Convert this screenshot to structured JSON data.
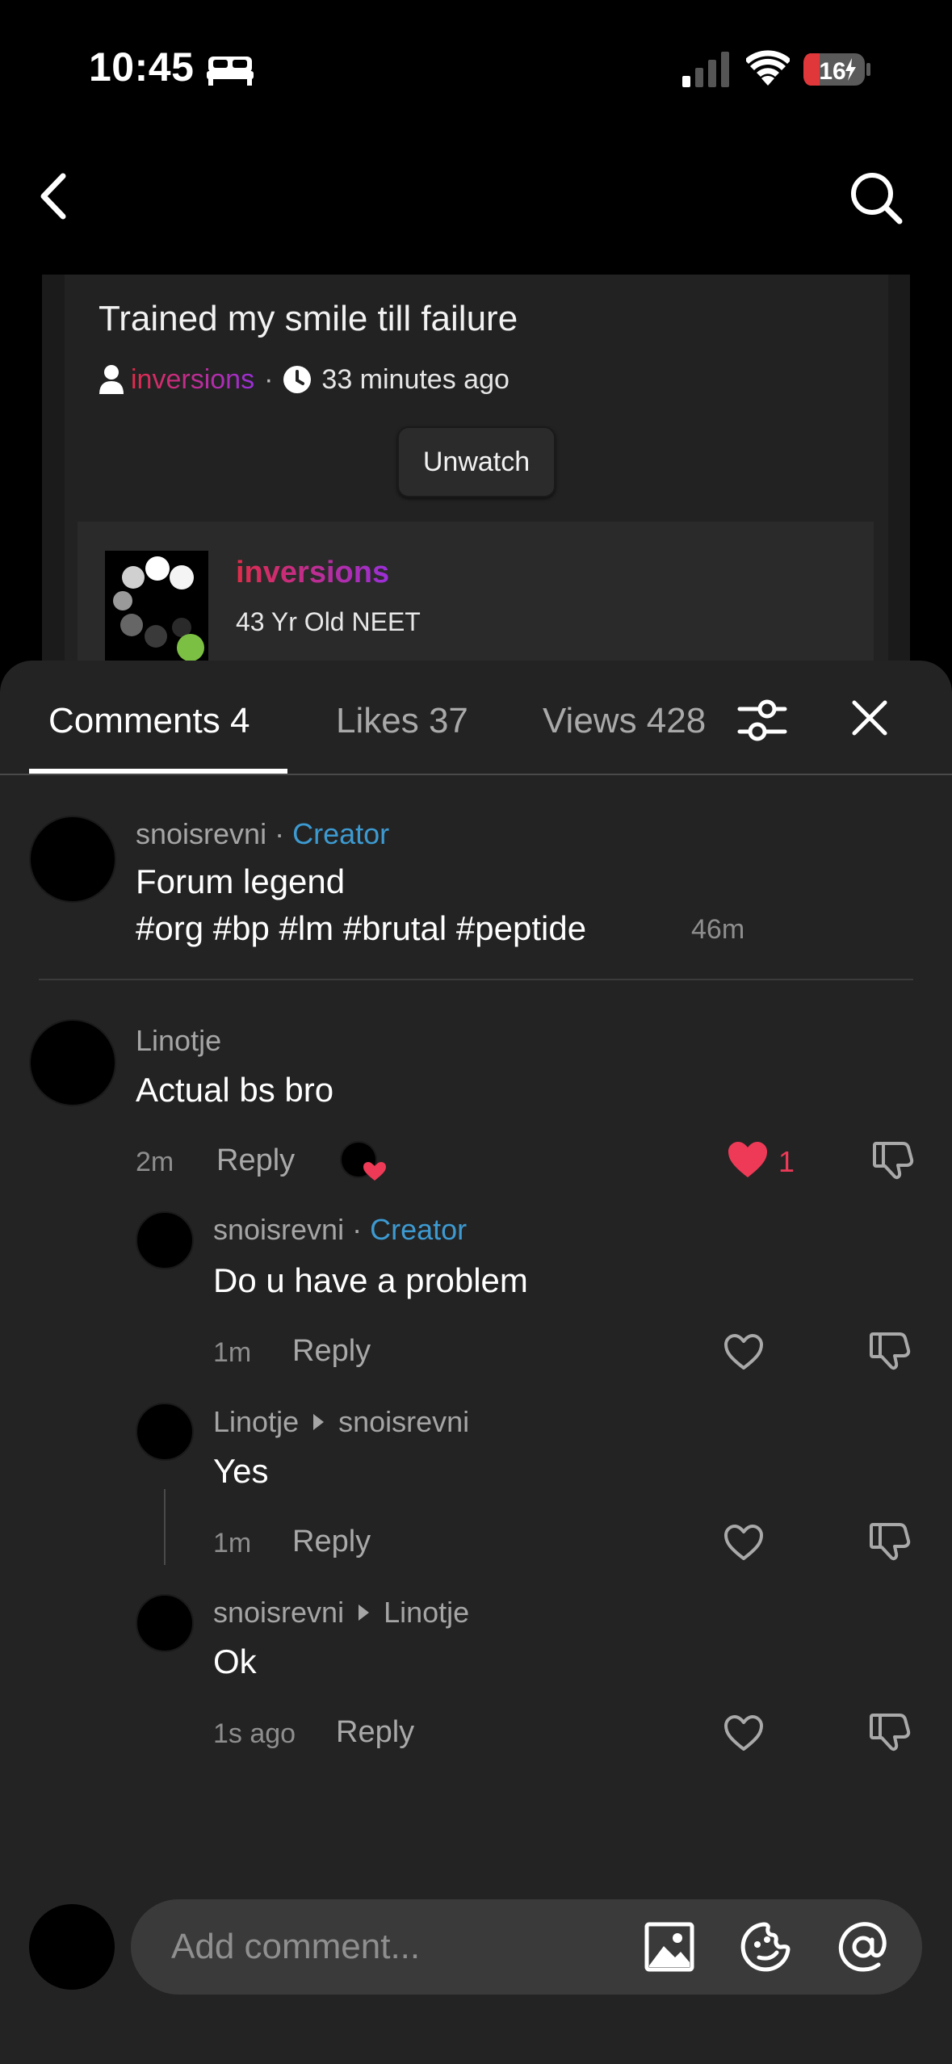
{
  "status_bar": {
    "time": "10:45",
    "battery": "16"
  },
  "post": {
    "title": "Trained my smile till failure",
    "author": "inversions",
    "meta_separator": "·",
    "time_ago": "33 minutes ago",
    "watch_button": "Unwatch"
  },
  "profile": {
    "name": "inversions",
    "bio": "43 Yr Old NEET"
  },
  "tabs": {
    "comments": "Comments 4",
    "likes": "Likes 37",
    "views": "Views 428"
  },
  "creator_comment": {
    "username": "snoisrevni",
    "separator": "·",
    "badge": "Creator",
    "line1": "Forum legend",
    "line2": "#org #bp #lm #brutal #peptide",
    "time": "46m"
  },
  "comments": [
    {
      "username": "Linotje",
      "text": "Actual bs bro",
      "time": "2m",
      "reply": "Reply",
      "likes": "1",
      "liked": true
    },
    {
      "username": "snoisrevni",
      "separator": "·",
      "badge": "Creator",
      "text": "Do u have a problem",
      "time": "1m",
      "reply": "Reply"
    },
    {
      "username": "Linotje",
      "reply_to": "snoisrevni",
      "text": "Yes",
      "time": "1m",
      "reply": "Reply"
    },
    {
      "username": "snoisrevni",
      "reply_to": "Linotje",
      "text": "Ok",
      "time": "1s ago",
      "reply": "Reply"
    }
  ],
  "composer": {
    "placeholder": "Add comment..."
  },
  "colors": {
    "accent_link": "#3d9ad1",
    "like_red": "#ee3a57",
    "author_gradient_start": "#e02c4a",
    "author_gradient_end": "#9a2fd8"
  },
  "icons": [
    "bed-icon",
    "signal-icon",
    "wifi-icon",
    "battery-icon",
    "back-icon",
    "search-icon",
    "user-icon",
    "clock-icon",
    "filter-icon",
    "close-icon",
    "heart-icon",
    "dislike-icon",
    "image-icon",
    "sticker-icon",
    "at-icon"
  ]
}
